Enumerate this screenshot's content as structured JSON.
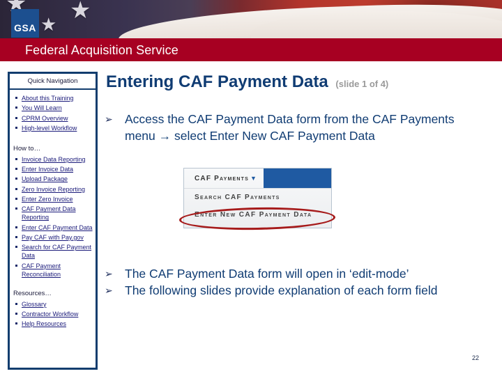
{
  "header": {
    "logo_text": "GSA",
    "banner_title": "Federal Acquisition Service"
  },
  "sidebar": {
    "title": "Quick Navigation",
    "top_links": [
      {
        "label": "About this Training"
      },
      {
        "label": "You Will Learn"
      },
      {
        "label": "CPRM Overview"
      },
      {
        "label": "High-level Workflow"
      }
    ],
    "howto_label": "How to…",
    "howto_links": [
      {
        "label": "Invoice Data Reporting"
      },
      {
        "label": "Enter Invoice Data"
      },
      {
        "label": "Upload Package"
      },
      {
        "label": "Zero Invoice Reporting"
      },
      {
        "label": "Enter Zero Invoice"
      },
      {
        "label": "CAF Payment Data Reporting"
      },
      {
        "label": "Enter CAF Payment Data"
      },
      {
        "label": "Pay CAF with Pay.gov"
      },
      {
        "label": "Search for CAF Payment Data"
      },
      {
        "label": "CAF Payment Reconciliation"
      }
    ],
    "resources_label": "Resources…",
    "resources_links": [
      {
        "label": "Glossary"
      },
      {
        "label": "Contractor Workflow"
      },
      {
        "label": "Help Resources"
      }
    ]
  },
  "main": {
    "title": "Entering CAF Payment Data",
    "subtitle": "(slide 1 of 4)",
    "bullets_top": [
      {
        "icon": "arrow-bullet-icon",
        "text": "Access the CAF Payment Data form from the CAF Payments menu → select Enter New CAF Payment Data"
      }
    ],
    "menu_screenshot": {
      "menu_tab": "CAF Payments",
      "caret_icon": "caret-down-icon",
      "item_search": "Search CAF Payments",
      "item_enter": "Enter New CAF Payment Data",
      "highlight_color": "#a61b1b"
    },
    "bullets_bottom": [
      {
        "icon": "arrow-bullet-icon",
        "text": "The CAF Payment Data form will open in ‘edit-mode’"
      },
      {
        "icon": "arrow-bullet-icon",
        "text": "The following slides provide explanation of each form field"
      }
    ]
  },
  "footer": {
    "page_number": "22"
  },
  "colors": {
    "title_blue": "#103c73",
    "banner_red": "#a70022",
    "sidebar_border": "#123d6e",
    "gsa_blue": "#1c4f8f",
    "menu_blue": "#1f5aa2"
  }
}
